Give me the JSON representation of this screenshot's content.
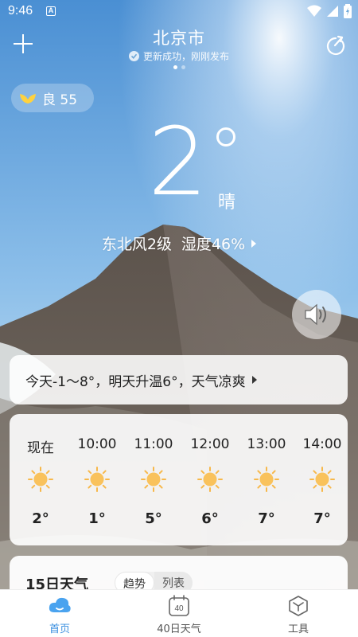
{
  "status_bar": {
    "time": "9:46",
    "notification_badge": "A"
  },
  "header": {
    "city": "北京市",
    "update_text": "更新成功，刚刚发布",
    "page_count": 2,
    "active_page": 0
  },
  "aqi": {
    "label": "良 55"
  },
  "current": {
    "temperature": "2",
    "condition": "晴",
    "wind": "东北风2级",
    "humidity": "湿度46%"
  },
  "summary": {
    "text": "今天-1～8°，明天升温6°，天气凉爽"
  },
  "hourly": [
    {
      "time": "现在",
      "icon": "sun-icon",
      "temp": "2°"
    },
    {
      "time": "10:00",
      "icon": "sun-icon",
      "temp": "1°"
    },
    {
      "time": "11:00",
      "icon": "sun-icon",
      "temp": "5°"
    },
    {
      "time": "12:00",
      "icon": "sun-icon",
      "temp": "6°"
    },
    {
      "time": "13:00",
      "icon": "sun-icon",
      "temp": "7°"
    },
    {
      "time": "14:00",
      "icon": "sun-icon",
      "temp": "7°"
    }
  ],
  "daily": {
    "title": "15日天气",
    "tabs": [
      "趋势",
      "列表"
    ],
    "active_tab": 0
  },
  "nav": {
    "items": [
      {
        "label": "首页",
        "icon": "cloud-home-icon",
        "active": true
      },
      {
        "label": "40日天气",
        "icon": "calendar-40-icon",
        "active": false
      },
      {
        "label": "工具",
        "icon": "tools-icon",
        "active": false
      }
    ],
    "calendar_number": "40"
  },
  "colors": {
    "accent": "#3a8fe0",
    "sun": "#f7b84a"
  }
}
